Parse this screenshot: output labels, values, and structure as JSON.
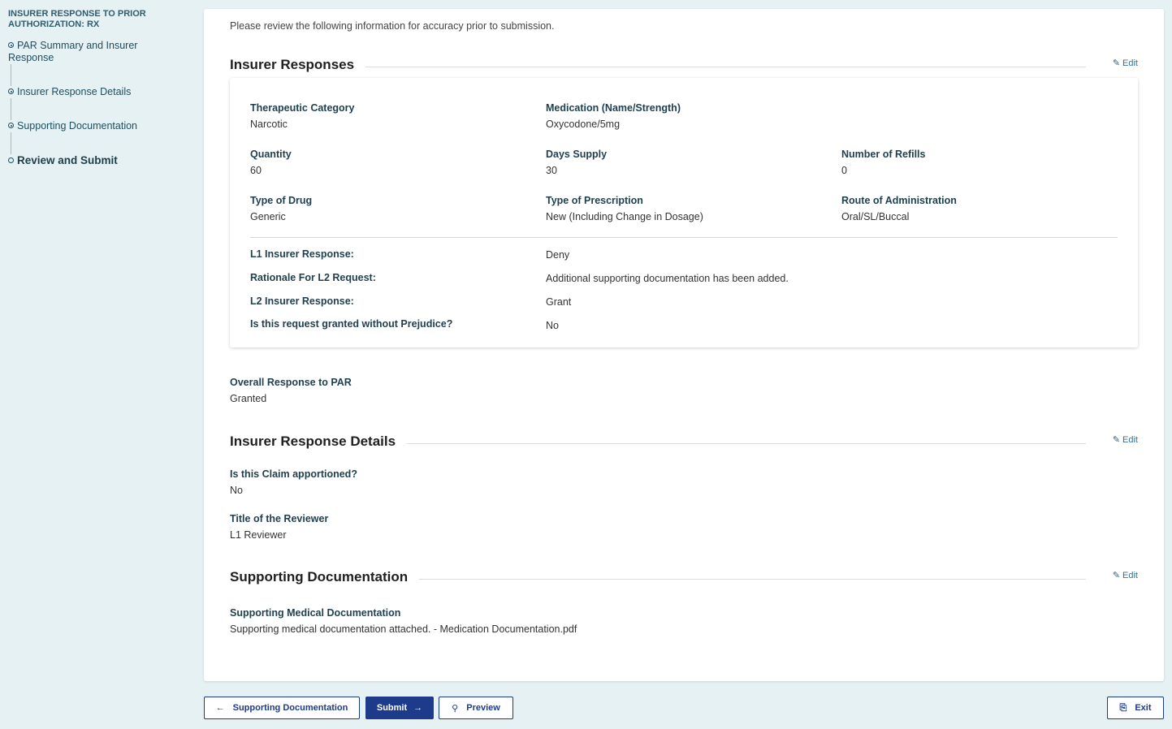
{
  "sidebar": {
    "title": "INSURER RESPONSE TO PRIOR AUTHORIZATION: RX",
    "items": [
      {
        "label": "PAR Summary and Insurer Response"
      },
      {
        "label": "Insurer Response Details"
      },
      {
        "label": "Supporting Documentation"
      },
      {
        "label": "Review and Submit"
      }
    ]
  },
  "main": {
    "intro": "Please review the following information for accuracy prior to submission.",
    "edit_label": "Edit",
    "insurer_responses": {
      "title": "Insurer Responses",
      "fields": {
        "therapeutic_category": {
          "label": "Therapeutic Category",
          "value": "Narcotic"
        },
        "medication": {
          "label": "Medication (Name/Strength)",
          "value": "Oxycodone/5mg"
        },
        "quantity": {
          "label": "Quantity",
          "value": "60"
        },
        "days_supply": {
          "label": "Days Supply",
          "value": "30"
        },
        "refills": {
          "label": "Number of Refills",
          "value": "0"
        },
        "type_of_drug": {
          "label": "Type of Drug",
          "value": "Generic"
        },
        "type_of_prescription": {
          "label": "Type of Prescription",
          "value": "New (Including Change in Dosage)"
        },
        "route": {
          "label": "Route of Administration",
          "value": "Oral/SL/Buccal"
        }
      },
      "rows": [
        {
          "label": "L1 Insurer Response:",
          "value": "Deny"
        },
        {
          "label": "Rationale For L2 Request:",
          "value": "Additional supporting documentation has been added."
        },
        {
          "label": "L2 Insurer Response:",
          "value": "Grant"
        },
        {
          "label": "Is this request granted without Prejudice?",
          "value": "No"
        }
      ],
      "overall": {
        "label": "Overall Response to PAR",
        "value": "Granted"
      }
    },
    "details": {
      "title": "Insurer Response Details",
      "apportioned": {
        "label": "Is this Claim apportioned?",
        "value": "No"
      },
      "reviewer": {
        "label": "Title of the Reviewer",
        "value": "L1 Reviewer"
      }
    },
    "supporting": {
      "title": "Supporting Documentation",
      "medical": {
        "label": "Supporting Medical Documentation",
        "value": "Supporting medical documentation attached.  - Medication Documentation.pdf"
      }
    }
  },
  "footer": {
    "back_label": "Supporting Documentation",
    "submit_label": "Submit",
    "preview_label": "Preview",
    "exit_label": "Exit"
  }
}
